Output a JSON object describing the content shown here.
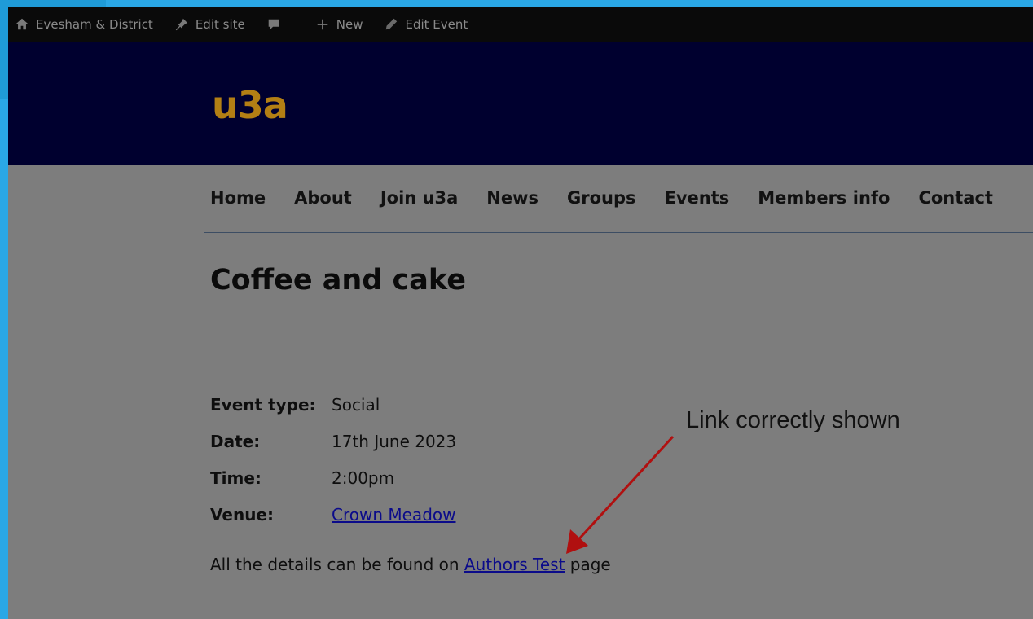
{
  "adminbar": {
    "site_name": "Evesham & District",
    "edit_site": "Edit site",
    "new": "New",
    "edit_event": "Edit Event"
  },
  "header": {
    "logo_text": "u3a"
  },
  "nav": {
    "items": [
      {
        "label": "Home"
      },
      {
        "label": "About"
      },
      {
        "label": "Join u3a"
      },
      {
        "label": "News"
      },
      {
        "label": "Groups"
      },
      {
        "label": "Events"
      },
      {
        "label": "Members info"
      },
      {
        "label": "Contact"
      }
    ]
  },
  "event": {
    "title": "Coffee and cake",
    "details": [
      {
        "label": "Event type:",
        "value": "Social"
      },
      {
        "label": "Date:",
        "value": "17th June 2023"
      },
      {
        "label": "Time:",
        "value": "2:00pm"
      },
      {
        "label": "Venue:",
        "value": "Crown Meadow"
      }
    ],
    "sentence_before": "All the details can be found on ",
    "sentence_link": "Authors Test",
    "sentence_after": " page"
  },
  "annotation": {
    "text": "Link correctly shown"
  },
  "colors": {
    "adminbar_bg": "#0a0a0a",
    "header_bg": "#00002f",
    "logo": "#b37f14",
    "page_bg": "#7d7d7d",
    "link": "#0b0b8a",
    "arrow": "#b01010",
    "frame": "#2aa7e6"
  }
}
